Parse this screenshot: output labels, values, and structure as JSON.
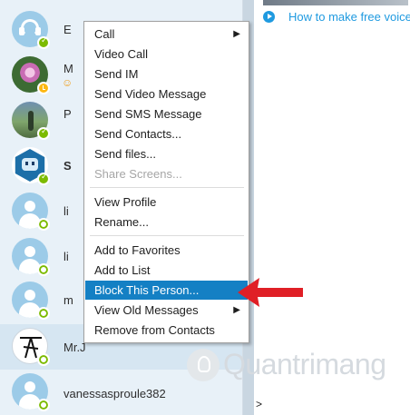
{
  "contacts": [
    {
      "name": "E",
      "avatar": "headset",
      "status": "online",
      "bold": false
    },
    {
      "name": "M",
      "avatar": "photo-flower",
      "status": "away",
      "bold": false,
      "emoji": "☺"
    },
    {
      "name": "P",
      "avatar": "photo-person",
      "status": "online",
      "bold": false
    },
    {
      "name": "S",
      "avatar": "photo-bot",
      "status": "online",
      "bold": true
    },
    {
      "name": "li",
      "avatar": "default",
      "status": "offline",
      "bold": false
    },
    {
      "name": "li",
      "avatar": "default",
      "status": "offline",
      "bold": false
    },
    {
      "name": "m",
      "avatar": "default",
      "status": "offline",
      "bold": false
    },
    {
      "name": "Mr.J",
      "avatar": "photo-mrj",
      "status": "offline",
      "bold": false,
      "selected": true
    },
    {
      "name": "vanessasproule382",
      "avatar": "default",
      "status": "offline",
      "bold": false
    }
  ],
  "context_menu": {
    "items": [
      {
        "label": "Call",
        "submenu": true
      },
      {
        "label": "Video Call"
      },
      {
        "label": "Send IM"
      },
      {
        "label": "Send Video Message"
      },
      {
        "label": "Send SMS Message"
      },
      {
        "label": "Send Contacts..."
      },
      {
        "label": "Send files..."
      },
      {
        "label": "Share Screens...",
        "disabled": true
      },
      {
        "label": "View Profile"
      },
      {
        "label": "Rename..."
      },
      {
        "label": "Add to Favorites"
      },
      {
        "label": "Add to List"
      },
      {
        "label": "Block This Person...",
        "highlighted": true
      },
      {
        "label": "View Old Messages",
        "submenu": true
      },
      {
        "label": "Remove from Contacts"
      }
    ],
    "submenu_arrow": "▶"
  },
  "chat": {
    "video_link": "How to make free voice",
    "caret": ">"
  },
  "watermark": {
    "text": "Quantrimang"
  },
  "colors": {
    "highlight": "#1480c4",
    "online": "#7cbb00",
    "away": "#fdb813",
    "link": "#1f9ae0",
    "annotation": "#e01f26"
  }
}
